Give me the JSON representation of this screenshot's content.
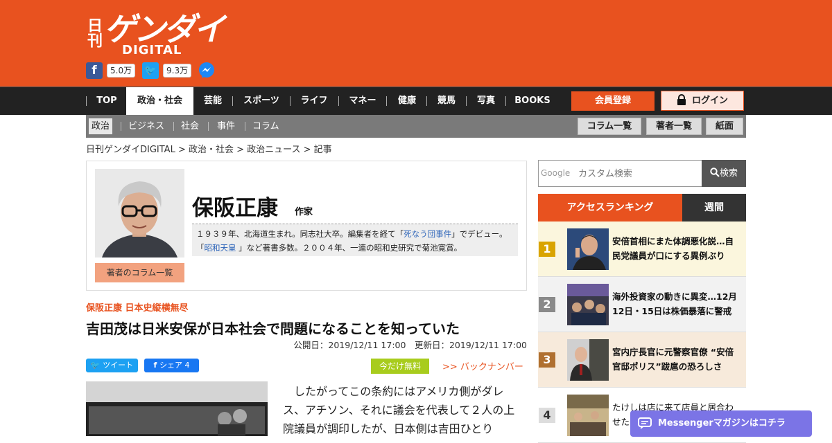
{
  "logo": {
    "side": "日刊",
    "main": "ゲンダイ",
    "sub": "DIGITAL"
  },
  "social": {
    "facebook_count": "5.0万",
    "twitter_count": "9.3万"
  },
  "nav": {
    "items": [
      "TOP",
      "政治・社会",
      "芸能",
      "スポーツ",
      "ライフ",
      "マネー",
      "健康",
      "競馬",
      "写真",
      "BOOKS"
    ],
    "active": "政治・社会",
    "register": "会員登録",
    "login": "ログイン"
  },
  "subnav": {
    "items": [
      "政治",
      "ビジネス",
      "社会",
      "事件",
      "コラム"
    ],
    "buttons": [
      "コラム一覧",
      "著者一覧",
      "紙面"
    ]
  },
  "breadcrumb": "日刊ゲンダイDIGITAL > 政治・社会 > 政治ニュース > 記事",
  "author": {
    "name": "保阪正康",
    "role": "作家",
    "bio_1": "１９３９年、北海道生まれ。同志社大卒。編集者を経て「",
    "bio_link1": "死なう団事件",
    "bio_2": "」でデビュー。「",
    "bio_link2": "昭和天皇",
    "bio_3": " 」など著書多数。２００４年、一連の昭和史研究で菊池寛賞。",
    "column_link": "著者のコラム一覧"
  },
  "article": {
    "series": "保阪正康 日本史縦横無尽",
    "title": "吉田茂は日米安保が日本社会で問題になることを知っていた",
    "dates": "公開日：2019/12/11 17:00　更新日：2019/12/11 17:00",
    "tweet": "ツイート",
    "share": "シェア 4",
    "free_badge": "今だけ無料",
    "backnumber": ">> バックナンバー",
    "body": "したがってこの条約にはアメリカ側がダレス、アチソン、それに議会を代表して２人の上院議員が調印したが、日本側は吉田ひとり"
  },
  "search": {
    "placeholder": "カスタム検索",
    "google": "Google",
    "button": "検索"
  },
  "ranking": {
    "tab_access": "アクセスランキング",
    "tab_week": "週間",
    "items": [
      {
        "rank": "1",
        "title": "安倍首相にまた体調悪化説…自民党議員が口にする異例ぶり"
      },
      {
        "rank": "2",
        "title": "海外投資家の動きに異変…12月12日・15日は株価暴落に警戒"
      },
      {
        "rank": "3",
        "title": "宮内庁長官に元警察官僚 “安倍官邸ポリス”跋扈の恐ろしさ"
      },
      {
        "rank": "4",
        "title": "たけしは店に来て店員と居合わせた"
      }
    ]
  },
  "messenger": "Messengerマガジンはコチラ",
  "colors": {
    "brand": "#e8521f",
    "nav": "#222222",
    "rank1": "#d9a400",
    "rank2": "#8a8a8a",
    "rank3": "#b07030",
    "rank4": "#dddddd"
  }
}
